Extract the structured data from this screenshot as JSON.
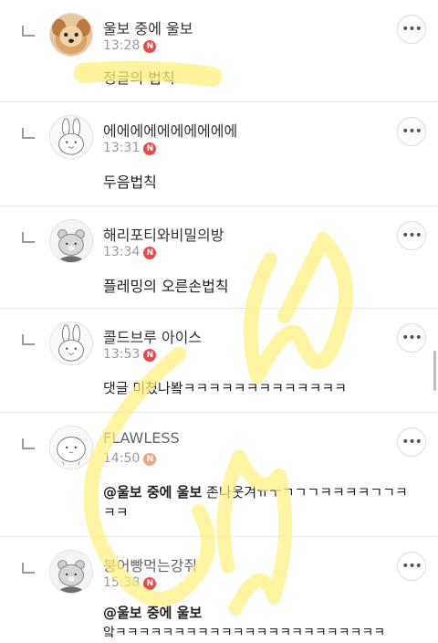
{
  "comments": [
    {
      "author": "울보 중에 울보",
      "time": "13:28",
      "badge": "N",
      "text": "정글의 법칙",
      "avatar": "puppy-photo"
    },
    {
      "author": "에에에에에에에에에에",
      "time": "13:31",
      "badge": "N",
      "text": "두음법칙",
      "avatar": "rabbit-default"
    },
    {
      "author": "해리포티와비밀의방",
      "time": "13:34",
      "badge": "N",
      "text": "플레밍의 오른손법칙",
      "avatar": "bear-default"
    },
    {
      "author": "콜드브루 아이스",
      "time": "13:53",
      "badge": "N",
      "text": "댓글 미쳤나봨ㅋㅋㅋㅋㅋㅋㅋㅋㅋㅋㅋㅋㅋ",
      "avatar": "rabbit-default"
    },
    {
      "author": "FLAWLESS",
      "time": "14:50",
      "badge": "N",
      "mention": "@울보 중에 울보",
      "text_line1": "존나웃겨ㅠㅜㄱㄱㄱㅋㅋㅋㅋㄱㄱㅋ",
      "text_line2": "ㅋㅋ",
      "avatar": "blob-default"
    },
    {
      "author": "붕어빵먹는강쥐",
      "time": "15:38",
      "badge": "N",
      "mention": "@울보 중에 울보",
      "text_line2": "앜ㅋㅋㅋㅋㅋㅋㅋㅋㅋㅋㅋㅋㅋㅋㅋㅋㅋㅋㅋㅋㅋㅋㅋ",
      "avatar": "bear-default"
    }
  ],
  "more_button_glyph": "•••",
  "colors": {
    "badge_red": "#f04848",
    "badge_orange": "#f6a37c",
    "highlighter_yellow": "#fff07a"
  }
}
